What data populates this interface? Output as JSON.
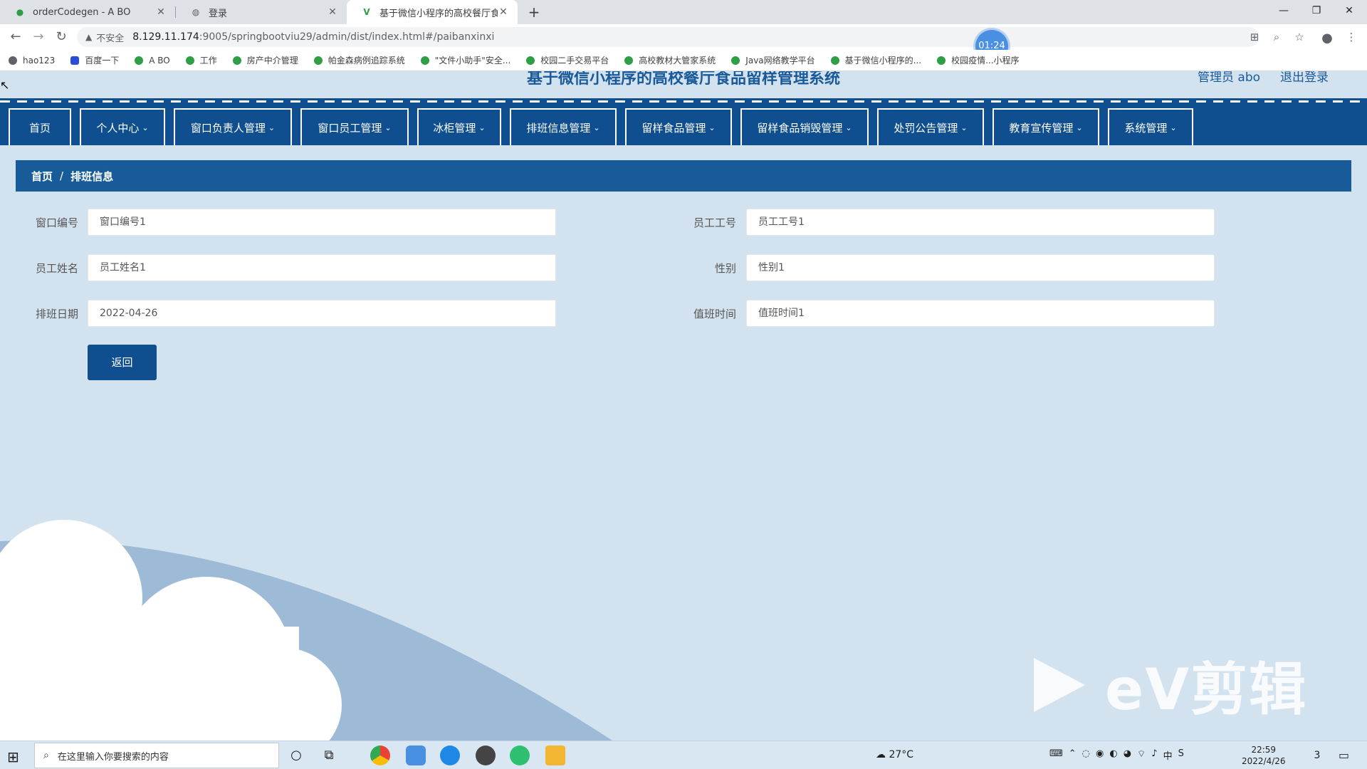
{
  "browser": {
    "tabs": [
      {
        "title": "orderCodegen - A BO",
        "active": false
      },
      {
        "title": "登录",
        "active": false
      },
      {
        "title": "基于微信小程序的高校餐厅食品留样管理系统",
        "active": true
      }
    ],
    "address": {
      "security_label": "不安全",
      "host": "8.129.11.174",
      "path": ":9005/springbootviu29/admin/dist/index.html#/paibanxinxi"
    },
    "recording_timer": "01:24",
    "bookmarks": [
      "hao123",
      "百度一下",
      "A BO",
      "工作",
      "房产中介管理",
      "帕金森病例追踪系统",
      "\"文件小助手\"安全...",
      "校园二手交易平台",
      "高校教材大管家系统",
      "Java网络教学平台",
      "基于微信小程序的...",
      "校园疫情...小程序"
    ]
  },
  "app": {
    "title": "基于微信小程序的高校餐厅食品留样管理系统",
    "user": "管理员 abo",
    "logout": "退出登录",
    "nav": [
      {
        "label": "首页",
        "has_menu": false
      },
      {
        "label": "个人中心",
        "has_menu": true
      },
      {
        "label": "窗口负责人管理",
        "has_menu": true
      },
      {
        "label": "窗口员工管理",
        "has_menu": true
      },
      {
        "label": "冰柜管理",
        "has_menu": true
      },
      {
        "label": "排班信息管理",
        "has_menu": true
      },
      {
        "label": "留样食品管理",
        "has_menu": true
      },
      {
        "label": "留样食品销毁管理",
        "has_menu": true
      },
      {
        "label": "处罚公告管理",
        "has_menu": true
      },
      {
        "label": "教育宣传管理",
        "has_menu": true
      },
      {
        "label": "系统管理",
        "has_menu": true
      }
    ],
    "breadcrumb": {
      "home": "首页",
      "separator": "/",
      "current": "排班信息"
    },
    "form": {
      "window_no": {
        "label": "窗口编号",
        "value": "窗口编号1"
      },
      "staff_no": {
        "label": "员工工号",
        "value": "员工工号1"
      },
      "staff_name": {
        "label": "员工姓名",
        "value": "员工姓名1"
      },
      "gender": {
        "label": "性别",
        "value": "性别1"
      },
      "shift_date": {
        "label": "排班日期",
        "value": "2022-04-26"
      },
      "duty_time": {
        "label": "值班时间",
        "value": "值班时间1"
      }
    },
    "back_button": "返回"
  },
  "watermark": "eV剪辑",
  "taskbar": {
    "search_placeholder": "在这里输入你要搜索的内容",
    "weather": "27°C",
    "time": "22:59",
    "date": "2022/4/26",
    "notifications": "3"
  },
  "colors": {
    "primary": "#0f4f8f",
    "breadcrumb": "#175b98",
    "background": "#d3e2ef"
  }
}
